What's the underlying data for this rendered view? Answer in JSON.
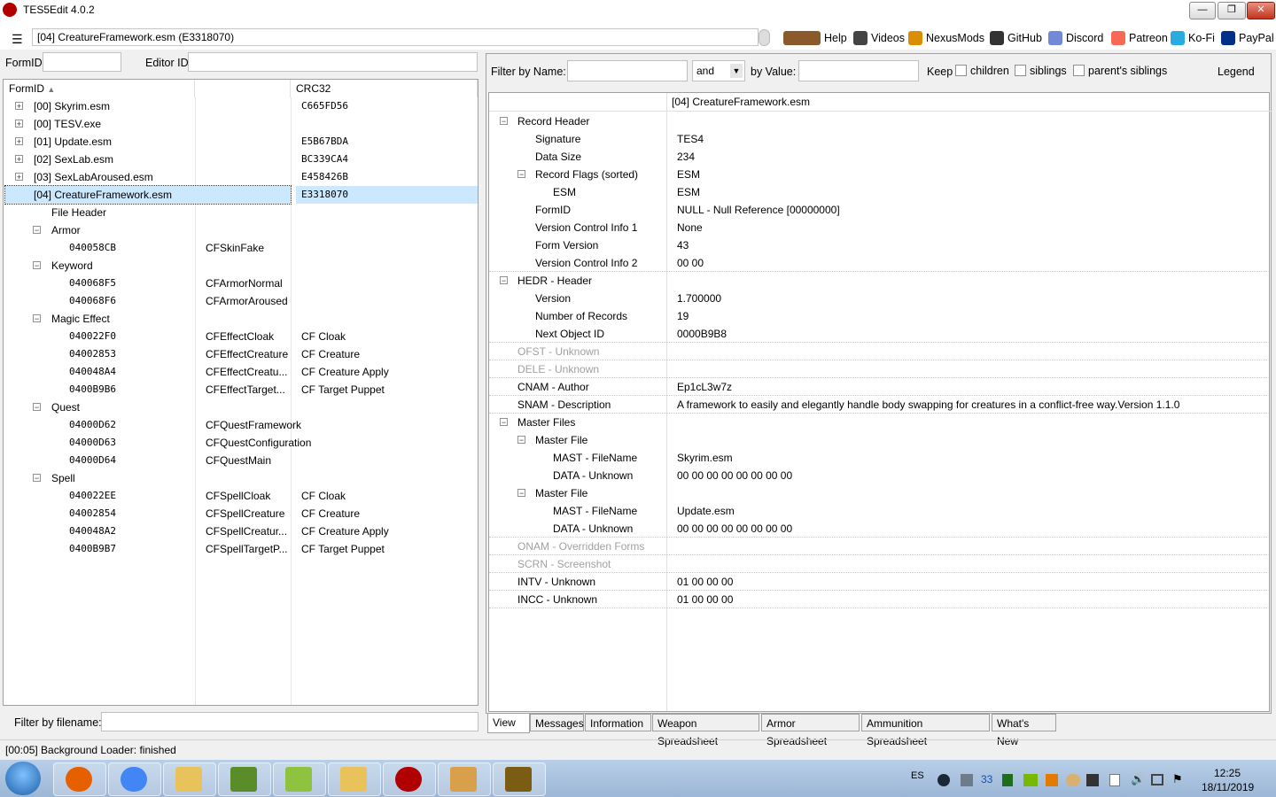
{
  "window": {
    "title": "TES5Edit 4.0.2",
    "min": "—",
    "max": "❐",
    "close": "✕"
  },
  "toolbar": {
    "menu_icon": "☰",
    "path": "[04] CreatureFramework.esm (E3318070)",
    "links": [
      {
        "label": "Help",
        "icon": "book-icon",
        "color": "#8b5a2b"
      },
      {
        "label": "Videos",
        "icon": "video-icon",
        "color": "#444444"
      },
      {
        "label": "NexusMods",
        "icon": "nexus-icon",
        "color": "#d98e04"
      },
      {
        "label": "GitHub",
        "icon": "github-icon",
        "color": "#333333"
      },
      {
        "label": "Discord",
        "icon": "discord-icon",
        "color": "#7289da"
      },
      {
        "label": "Patreon",
        "icon": "patreon-icon",
        "color": "#f96854"
      },
      {
        "label": "Ko-Fi",
        "icon": "kofi-icon",
        "color": "#29abe0"
      },
      {
        "label": "PayPal",
        "icon": "paypal-icon",
        "color": "#003087"
      }
    ]
  },
  "left_filters": {
    "formid_label": "FormID",
    "editorid_label": "Editor ID",
    "filename_label": "Filter by filename:"
  },
  "left_tree": {
    "columns": [
      "FormID",
      "",
      "CRC32"
    ],
    "rows": [
      {
        "toggle": "+",
        "formid": "[00] Skyrim.esm",
        "edid": "",
        "crc": "C665FD56"
      },
      {
        "toggle": "+",
        "formid": "[00] TESV.exe",
        "edid": "",
        "crc": ""
      },
      {
        "toggle": "+",
        "formid": "[01] Update.esm",
        "edid": "",
        "crc": "E5B67BDA"
      },
      {
        "toggle": "+",
        "formid": "[02] SexLab.esm",
        "edid": "",
        "crc": "BC339CA4"
      },
      {
        "toggle": "+",
        "formid": "[03] SexLabAroused.esm",
        "edid": "",
        "crc": "E458426B"
      },
      {
        "toggle": "−",
        "formid": "[04] CreatureFramework.esm",
        "edid": "",
        "crc": "E3318070",
        "selected": true
      },
      {
        "toggle": "",
        "formid": "File Header",
        "edid": "",
        "crc": ""
      },
      {
        "toggle": "−",
        "formid": "Armor",
        "edid": "",
        "crc": ""
      },
      {
        "toggle": "",
        "formid": "040058CB",
        "edid": "CFSkinFake",
        "crc": "",
        "mono": true
      },
      {
        "toggle": "−",
        "formid": "Keyword",
        "edid": "",
        "crc": ""
      },
      {
        "toggle": "",
        "formid": "040068F5",
        "edid": "CFArmorNormal",
        "crc": "",
        "mono": true
      },
      {
        "toggle": "",
        "formid": "040068F6",
        "edid": "CFArmorAroused",
        "crc": "",
        "mono": true
      },
      {
        "toggle": "−",
        "formid": "Magic Effect",
        "edid": "",
        "crc": ""
      },
      {
        "toggle": "",
        "formid": "040022F0",
        "edid": "CFEffectCloak",
        "crc": "CF Cloak",
        "mono": true
      },
      {
        "toggle": "",
        "formid": "04002853",
        "edid": "CFEffectCreature",
        "crc": "CF Creature",
        "mono": true
      },
      {
        "toggle": "",
        "formid": "040048A4",
        "edid": "CFEffectCreatu...",
        "crc": "CF Creature Apply",
        "mono": true
      },
      {
        "toggle": "",
        "formid": "0400B9B6",
        "edid": "CFEffectTarget...",
        "crc": "CF Target Puppet",
        "mono": true
      },
      {
        "toggle": "−",
        "formid": "Quest",
        "edid": "",
        "crc": ""
      },
      {
        "toggle": "",
        "formid": "04000D62",
        "edid": "CFQuestFramework",
        "crc": "",
        "mono": true
      },
      {
        "toggle": "",
        "formid": "04000D63",
        "edid": "CFQuestConfiguration",
        "crc": "",
        "mono": true
      },
      {
        "toggle": "",
        "formid": "04000D64",
        "edid": "CFQuestMain",
        "crc": "",
        "mono": true
      },
      {
        "toggle": "−",
        "formid": "Spell",
        "edid": "",
        "crc": ""
      },
      {
        "toggle": "",
        "formid": "040022EE",
        "edid": "CFSpellCloak",
        "crc": "CF Cloak",
        "mono": true
      },
      {
        "toggle": "",
        "formid": "04002854",
        "edid": "CFSpellCreature",
        "crc": "CF Creature",
        "mono": true
      },
      {
        "toggle": "",
        "formid": "040048A2",
        "edid": "CFSpellCreatur...",
        "crc": "CF Creature Apply",
        "mono": true
      },
      {
        "toggle": "",
        "formid": "0400B9B7",
        "edid": "CFSpellTargetP...",
        "crc": "CF Target Puppet",
        "mono": true
      }
    ]
  },
  "right_filters": {
    "name_label": "Filter by Name:",
    "op": "and",
    "value_label": "by Value:",
    "keep": "Keep",
    "children": "children",
    "siblings": "siblings",
    "parents_siblings": "parent's siblings",
    "legend": "Legend"
  },
  "record": {
    "column_header": "[04] CreatureFramework.esm",
    "rows": [
      {
        "toggle": "−",
        "name": "Record Header",
        "value": ""
      },
      {
        "toggle": "",
        "name": "Signature",
        "value": "TES4"
      },
      {
        "toggle": "",
        "name": "Data Size",
        "value": "234"
      },
      {
        "toggle": "−",
        "name": "Record Flags (sorted)",
        "value": "ESM"
      },
      {
        "toggle": "",
        "name": "ESM",
        "value": "ESM"
      },
      {
        "toggle": "",
        "name": "FormID",
        "value": "NULL - Null Reference [00000000]"
      },
      {
        "toggle": "",
        "name": "Version Control Info 1",
        "value": "None"
      },
      {
        "toggle": "",
        "name": "Form Version",
        "value": "43"
      },
      {
        "toggle": "",
        "name": "Version Control Info 2",
        "value": "00 00"
      },
      {
        "toggle": "−",
        "name": "HEDR - Header",
        "value": ""
      },
      {
        "toggle": "",
        "name": "Version",
        "value": "1.700000"
      },
      {
        "toggle": "",
        "name": "Number of Records",
        "value": "19"
      },
      {
        "toggle": "",
        "name": "Next Object ID",
        "value": "0000B9B8"
      },
      {
        "toggle": "",
        "name": "OFST - Unknown",
        "value": "",
        "grey": true
      },
      {
        "toggle": "",
        "name": "DELE - Unknown",
        "value": "",
        "grey": true
      },
      {
        "toggle": "",
        "name": "CNAM - Author",
        "value": "Ep1cL3w7z"
      },
      {
        "toggle": "",
        "name": "SNAM - Description",
        "value": "A framework to easily and elegantly handle body swapping for creatures in a conflict-free way.Version 1.1.0"
      },
      {
        "toggle": "−",
        "name": "Master Files",
        "value": ""
      },
      {
        "toggle": "−",
        "name": "Master File",
        "value": ""
      },
      {
        "toggle": "",
        "name": "MAST - FileName",
        "value": "Skyrim.esm"
      },
      {
        "toggle": "",
        "name": "DATA - Unknown",
        "value": "00 00 00 00 00 00 00 00"
      },
      {
        "toggle": "−",
        "name": "Master File",
        "value": ""
      },
      {
        "toggle": "",
        "name": "MAST - FileName",
        "value": "Update.esm"
      },
      {
        "toggle": "",
        "name": "DATA - Unknown",
        "value": "00 00 00 00 00 00 00 00"
      },
      {
        "toggle": "",
        "name": "ONAM - Overridden Forms",
        "value": "",
        "grey": true
      },
      {
        "toggle": "",
        "name": "SCRN - Screenshot",
        "value": "",
        "grey": true
      },
      {
        "toggle": "",
        "name": "INTV - Unknown",
        "value": "01 00 00 00"
      },
      {
        "toggle": "",
        "name": "INCC - Unknown",
        "value": "01 00 00 00"
      }
    ]
  },
  "tabs": [
    "View",
    "Messages",
    "Information",
    "Weapon Spreadsheet",
    "Armor Spreadsheet",
    "Ammunition Spreadsheet",
    "What's New"
  ],
  "active_tab": "View",
  "status": "[00:05] Background Loader: finished",
  "taskbar": {
    "apps": [
      {
        "name": "firefox-icon",
        "color": "#e66000"
      },
      {
        "name": "chrome-icon",
        "color": "#4285f4"
      },
      {
        "name": "folder-icon",
        "color": "#e8c25a"
      },
      {
        "name": "minecraft-icon",
        "color": "#5b8c2a"
      },
      {
        "name": "notepad-plus-icon",
        "color": "#8fc23f"
      },
      {
        "name": "folder-icon",
        "color": "#e8c25a"
      },
      {
        "name": "tes5edit-icon",
        "color": "#b00000"
      },
      {
        "name": "tornado-icon",
        "color": "#d8a04a"
      },
      {
        "name": "fallout-icon",
        "color": "#7a5d12"
      }
    ],
    "lang": "ES",
    "tray_number": "33",
    "time": "12:25",
    "date": "18/11/2019"
  }
}
